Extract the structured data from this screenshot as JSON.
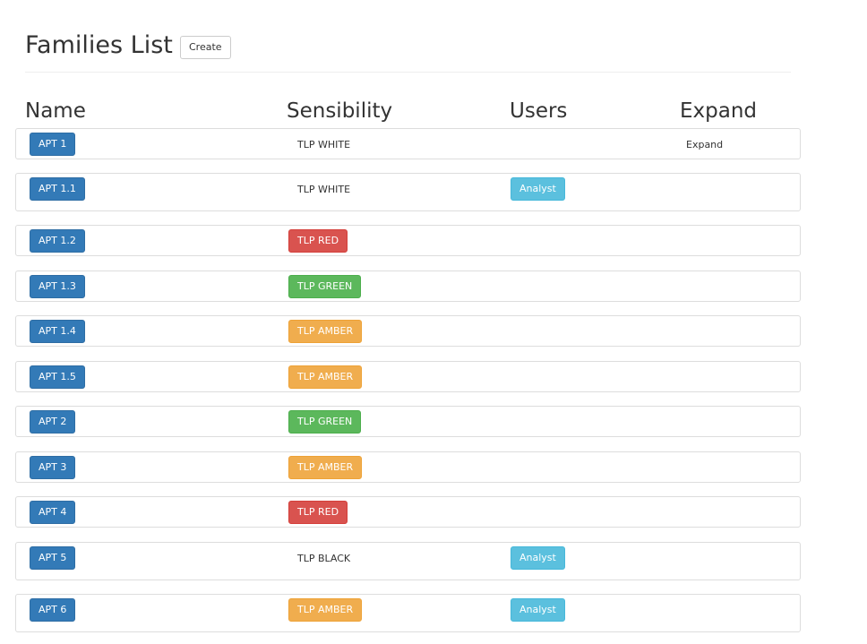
{
  "header": {
    "title": "Families List",
    "create_label": "Create"
  },
  "columns": {
    "name": "Name",
    "sensibility": "Sensibility",
    "users": "Users",
    "expand": "Expand"
  },
  "rows": [
    {
      "name": "APT 1",
      "tlp": "TLP WHITE",
      "tlp_style": "plain",
      "user": "",
      "expand": "Expand"
    },
    {
      "name": "APT 1.1",
      "tlp": "TLP WHITE",
      "tlp_style": "plain",
      "user": "Analyst",
      "expand": ""
    },
    {
      "name": "APT 1.2",
      "tlp": "TLP RED",
      "tlp_style": "red",
      "user": "",
      "expand": ""
    },
    {
      "name": "APT 1.3",
      "tlp": "TLP GREEN",
      "tlp_style": "green",
      "user": "",
      "expand": ""
    },
    {
      "name": "APT 1.4",
      "tlp": "TLP AMBER",
      "tlp_style": "amber",
      "user": "",
      "expand": ""
    },
    {
      "name": "APT 1.5",
      "tlp": "TLP AMBER",
      "tlp_style": "amber",
      "user": "",
      "expand": ""
    },
    {
      "name": "APT 2",
      "tlp": "TLP GREEN",
      "tlp_style": "green",
      "user": "",
      "expand": ""
    },
    {
      "name": "APT 3",
      "tlp": "TLP AMBER",
      "tlp_style": "amber",
      "user": "",
      "expand": ""
    },
    {
      "name": "APT 4",
      "tlp": "TLP RED",
      "tlp_style": "red",
      "user": "",
      "expand": ""
    },
    {
      "name": "APT 5",
      "tlp": "TLP BLACK",
      "tlp_style": "plain",
      "user": "Analyst",
      "expand": ""
    },
    {
      "name": "APT 6",
      "tlp": "TLP AMBER",
      "tlp_style": "amber",
      "user": "Analyst",
      "expand": ""
    }
  ],
  "colors": {
    "primary": "#337ab7",
    "danger": "#d9534f",
    "success": "#5cb85c",
    "warning": "#f0ad4e",
    "info": "#5bc0de"
  }
}
